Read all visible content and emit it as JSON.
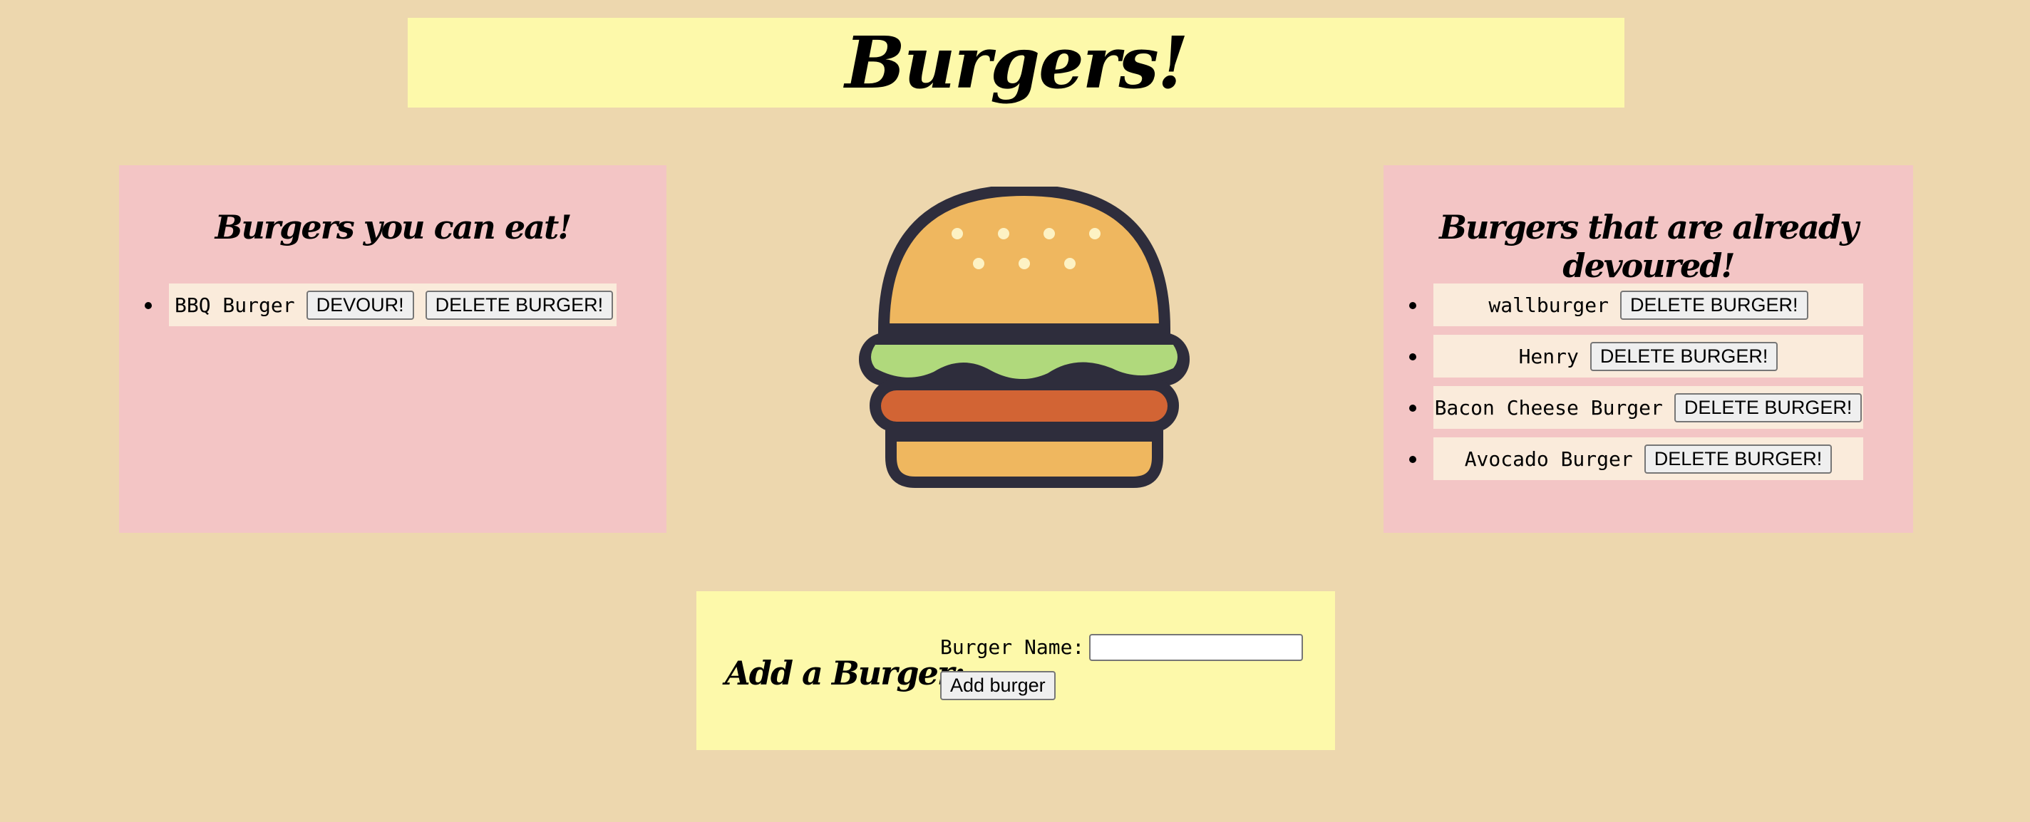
{
  "header": {
    "title": "Burgers!"
  },
  "uneaten": {
    "heading": "Burgers you can eat!",
    "items": [
      {
        "name": "BBQ Burger",
        "devour_label": "DEVOUR!",
        "delete_label": "DELETE BURGER!"
      }
    ]
  },
  "devoured": {
    "heading": "Burgers that are already devoured!",
    "items": [
      {
        "name": "wallburger",
        "delete_label": "DELETE BURGER!"
      },
      {
        "name": "Henry",
        "delete_label": "DELETE BURGER!"
      },
      {
        "name": "Bacon Cheese Burger",
        "delete_label": "DELETE BURGER!"
      },
      {
        "name": "Avocado Burger",
        "delete_label": "DELETE BURGER!"
      }
    ]
  },
  "form": {
    "heading": "Add a Burger:",
    "label": "Burger Name:",
    "input_value": "",
    "submit_label": "Add burger"
  },
  "icons": {
    "hero": "burger-icon"
  },
  "colors": {
    "background": "#edd7ae",
    "header": "#fdf9aa",
    "panel": "#f3c5c5",
    "item": "#faebdb"
  }
}
